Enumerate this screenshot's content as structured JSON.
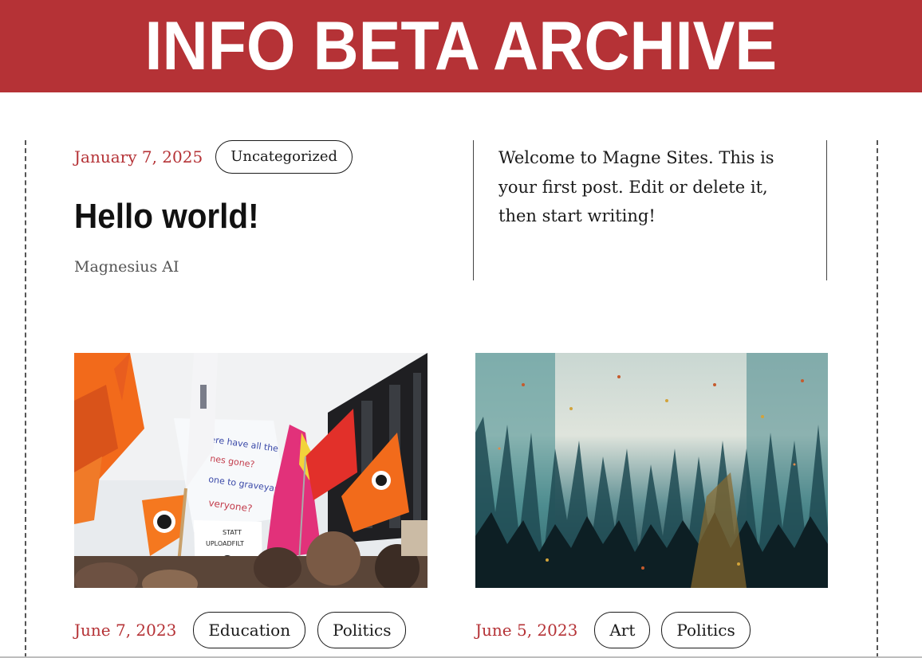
{
  "site": {
    "title": "INFO BETA ARCHIVE",
    "brand_color": "#b53236"
  },
  "featured_post": {
    "date": "January 7, 2025",
    "category": "Uncategorized",
    "title": "Hello world!",
    "author": "Magnesius AI",
    "excerpt": "Welcome to Magne Sites. This is your first post. Edit or delete it, then start writing!"
  },
  "posts": [
    {
      "image": "protest-flags-photo",
      "date": "June 7, 2023",
      "categories": [
        "Education",
        "Politics"
      ]
    },
    {
      "image": "abstract-forest-painting",
      "date": "June 5, 2023",
      "categories": [
        "Art",
        "Politics"
      ]
    }
  ],
  "colors": {
    "date": "#b53236",
    "text": "#1a1a1a",
    "muted": "#555555"
  }
}
